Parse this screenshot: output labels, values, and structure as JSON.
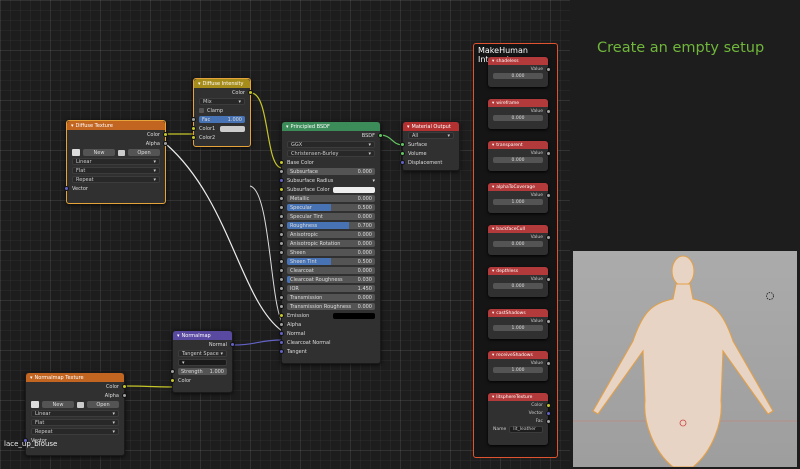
{
  "nodes": {
    "diffuse_texture": {
      "title": "Diffuse Texture",
      "out_color": "Color",
      "out_alpha": "Alpha",
      "new": "New",
      "open": "Open",
      "interpolation": "Linear",
      "projection": "Flat",
      "extension": "Repeat",
      "vector": "Vector"
    },
    "diffuse_intensity": {
      "title": "Diffuse Intensity",
      "out_color": "Color",
      "blend": "Mix",
      "clamp": "Clamp",
      "fac_label": "Fac",
      "fac_value": "1.000",
      "fac_fraction": 1.0,
      "color1": "Color1",
      "color2": "Color2"
    },
    "principled": {
      "title": "Principled BSDF",
      "out_bsdf": "BSDF",
      "distribution": "GGX",
      "subsurface_method": "Christensen-Burley",
      "rows": [
        {
          "label": "Base Color",
          "type": "socket",
          "sock": "yel"
        },
        {
          "label": "Subsurface",
          "type": "value",
          "value": "0.000",
          "fill": 0
        },
        {
          "label": "Subsurface Radius",
          "type": "drop",
          "sock": "pur"
        },
        {
          "label": "Subsurface Color",
          "type": "color",
          "sock": "yel"
        },
        {
          "label": "Metallic",
          "type": "value",
          "value": "0.000",
          "fill": 0
        },
        {
          "label": "Specular",
          "type": "value",
          "value": "0.500",
          "fill": 0.5
        },
        {
          "label": "Specular Tint",
          "type": "value",
          "value": "0.000",
          "fill": 0
        },
        {
          "label": "Roughness",
          "type": "value",
          "value": "0.700",
          "fill": 0.7
        },
        {
          "label": "Anisotropic",
          "type": "value",
          "value": "0.000",
          "fill": 0
        },
        {
          "label": "Anisotropic Rotation",
          "type": "value",
          "value": "0.000",
          "fill": 0
        },
        {
          "label": "Sheen",
          "type": "value",
          "value": "0.000",
          "fill": 0
        },
        {
          "label": "Sheen Tint",
          "type": "value",
          "value": "0.500",
          "fill": 0.5
        },
        {
          "label": "Clearcoat",
          "type": "value",
          "value": "0.000",
          "fill": 0
        },
        {
          "label": "Clearcoat Roughness",
          "type": "value",
          "value": "0.030",
          "fill": 0.03
        },
        {
          "label": "IOR",
          "type": "value",
          "value": "1.450",
          "fill": 0
        },
        {
          "label": "Transmission",
          "type": "value",
          "value": "0.000",
          "fill": 0
        },
        {
          "label": "Transmission Roughness",
          "type": "value",
          "value": "0.000",
          "fill": 0
        },
        {
          "label": "Emission",
          "type": "black",
          "sock": "yel"
        },
        {
          "label": "Alpha",
          "type": "socket",
          "sock": "gry"
        },
        {
          "label": "Normal",
          "type": "socket",
          "sock": "pur"
        },
        {
          "label": "Clearcoat Normal",
          "type": "socket",
          "sock": "pur"
        },
        {
          "label": "Tangent",
          "type": "socket",
          "sock": "pur"
        }
      ]
    },
    "material_output": {
      "title": "Material Output",
      "target": "All",
      "surface": "Surface",
      "volume": "Volume",
      "displacement": "Displacement"
    },
    "normalmap": {
      "title": "Normalmap",
      "out_normal": "Normal",
      "space": "Tangent Space",
      "strength_label": "Strength",
      "strength_value": "1.000",
      "color": "Color"
    },
    "normalmap_texture": {
      "title": "Normalmap Texture",
      "out_color": "Color",
      "out_alpha": "Alpha",
      "new": "New",
      "open": "Open",
      "interpolation": "Linear",
      "projection": "Flat",
      "extension": "Repeat",
      "vector": "Vector"
    }
  },
  "makehuman": {
    "title": "MakeHuman Internal",
    "value_label": "Value",
    "items": [
      {
        "title": "shadeless",
        "value": "0.000"
      },
      {
        "title": "wireframe",
        "value": "0.000"
      },
      {
        "title": "transparent",
        "value": "0.000"
      },
      {
        "title": "alphaToCoverage",
        "value": "1.000"
      },
      {
        "title": "backfaceCull",
        "value": "0.000"
      },
      {
        "title": "depthless",
        "value": "0.000"
      },
      {
        "title": "castShadows",
        "value": "1.000"
      },
      {
        "title": "receiveShadows",
        "value": "1.000"
      }
    ],
    "feather": {
      "title": "litsphereTexture",
      "outputs": [
        "Color",
        "Vector",
        "Fac"
      ],
      "name_label": "Name",
      "name_value": "lit_leather"
    }
  },
  "setup_text": "Create an empty setup",
  "blouse_label": "lace_up_blouse",
  "colors": {
    "shader_header": "#3c8c5a",
    "texture_header": "#c26520",
    "color_header": "#a68c1a",
    "vector_header": "#5a49a0",
    "output_header": "#b33131",
    "accent": "#6fb63b"
  }
}
